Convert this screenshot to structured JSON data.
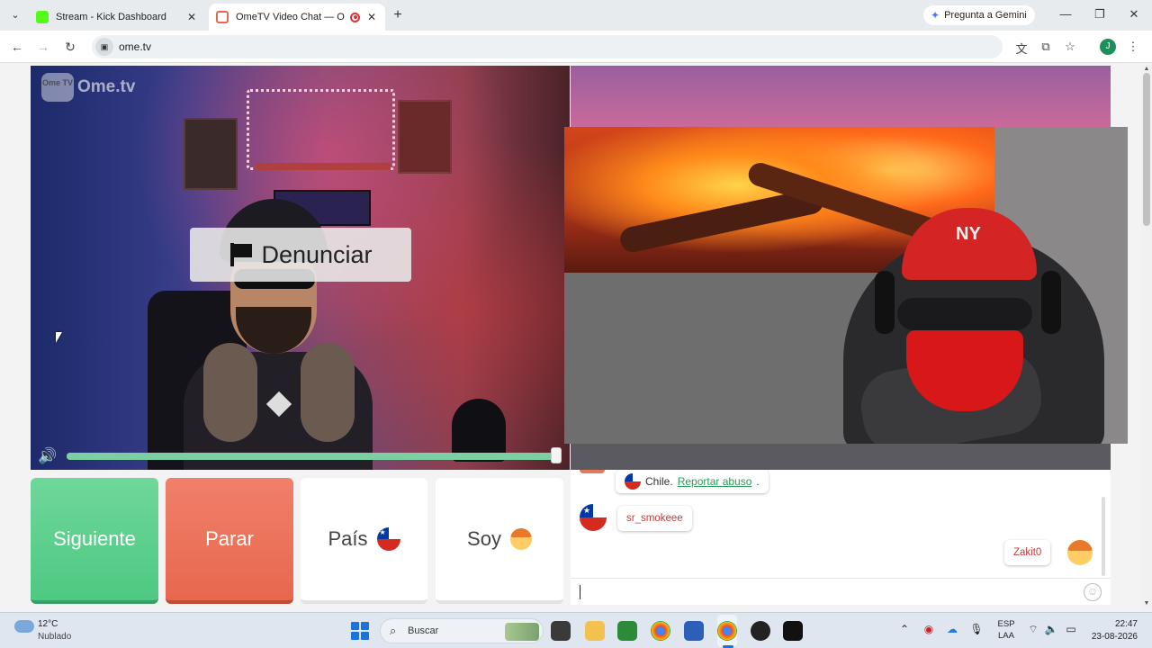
{
  "browser": {
    "tabs": [
      {
        "title": "Stream - Kick Dashboard",
        "favicon_color": "#53fc18"
      },
      {
        "title": "OmeTV Video Chat — Ome",
        "favicon_color": "#e26a4f",
        "recording": true,
        "active": true
      }
    ],
    "gemini_label": "Pregunta a Gemini",
    "url": "ome.tv",
    "profile_initial": "J"
  },
  "video": {
    "logo_badge": "Ome TV",
    "logo_text": "Ome.tv",
    "report_label": "Denunciar",
    "volume_fraction": 1.0,
    "remote_cap_text": "NY"
  },
  "controls": {
    "next_label": "Siguiente",
    "stop_label": "Parar",
    "country_label": "País",
    "self_label": "Soy"
  },
  "chat": {
    "system_country": "Chile.",
    "report_abuse_link": "Reportar abuso",
    "system_suffix": ".",
    "remote_username": "sr_smokeee",
    "self_username": "Zakit0",
    "input_value": ""
  },
  "taskbar": {
    "temperature": "12°C",
    "weather": "Nublado",
    "search_placeholder": "Buscar",
    "language_line1": "ESP",
    "language_line2": "LAA",
    "time": "22:47",
    "date": "23-08-2026"
  },
  "colors": {
    "next_button": "#4ec882",
    "stop_button": "#e8674e",
    "link_green": "#2a9a5a",
    "username_red": "#c23a3a"
  }
}
